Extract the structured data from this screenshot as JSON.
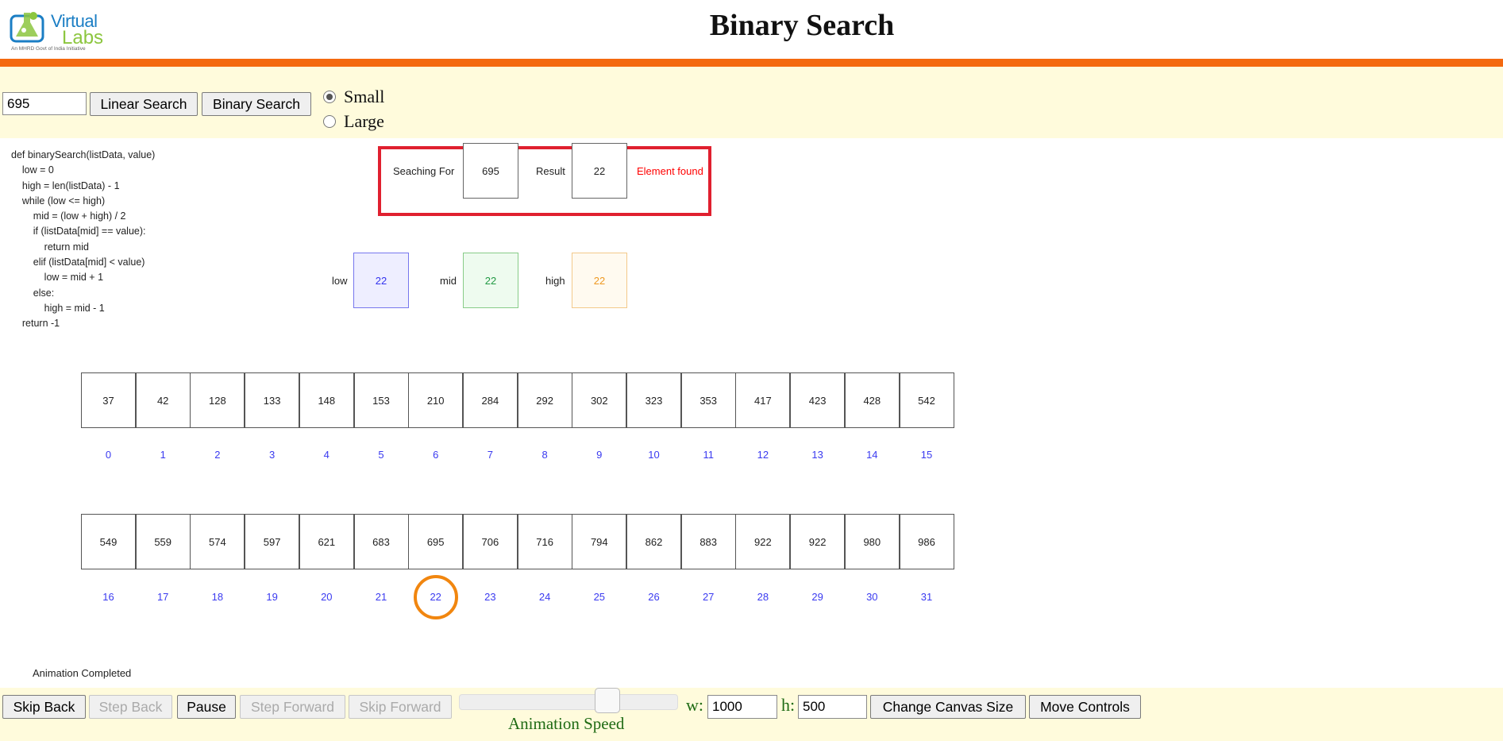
{
  "header": {
    "logo_line1": "Virtual",
    "logo_line2": "Labs",
    "logo_tagline": "An MHRD Govt of India Initiative",
    "title": "Binary Search"
  },
  "top_controls": {
    "search_value": "695",
    "linear_search_label": "Linear Search",
    "binary_search_label": "Binary Search",
    "size_options": [
      {
        "label": "Small",
        "selected": true
      },
      {
        "label": "Large",
        "selected": false
      }
    ]
  },
  "code_lines": [
    "def binarySearch(listData, value)",
    "    low = 0",
    "    high = len(listData) - 1",
    "    while (low <= high)",
    "        mid = (low + high) / 2",
    "        if (listData[mid] == value):",
    "            return mid",
    "        elif (listData[mid] < value)",
    "            low = mid + 1",
    "        else:",
    "            high = mid - 1",
    "    return -1"
  ],
  "search_panel": {
    "searching_for_label": "Seaching For",
    "searching_for_value": "695",
    "result_label": "Result",
    "result_value": "22",
    "message": "Element found",
    "highlight_color": "#e0202f",
    "message_color": "#ff0000"
  },
  "pointers": {
    "low": {
      "label": "low",
      "value": "22",
      "color": "#3333ee"
    },
    "mid": {
      "label": "mid",
      "value": "22",
      "color": "#229944"
    },
    "high": {
      "label": "high",
      "value": "22",
      "color": "#ee9922"
    }
  },
  "array": {
    "rows": [
      {
        "values": [
          "37",
          "42",
          "128",
          "133",
          "148",
          "153",
          "210",
          "284",
          "292",
          "302",
          "323",
          "353",
          "417",
          "423",
          "428",
          "542"
        ],
        "indices": [
          "0",
          "1",
          "2",
          "3",
          "4",
          "5",
          "6",
          "7",
          "8",
          "9",
          "10",
          "11",
          "12",
          "13",
          "14",
          "15"
        ]
      },
      {
        "values": [
          "549",
          "559",
          "574",
          "597",
          "621",
          "683",
          "695",
          "706",
          "716",
          "794",
          "862",
          "883",
          "922",
          "922",
          "980",
          "986"
        ],
        "indices": [
          "16",
          "17",
          "18",
          "19",
          "20",
          "21",
          "22",
          "23",
          "24",
          "25",
          "26",
          "27",
          "28",
          "29",
          "30",
          "31"
        ]
      }
    ],
    "found_index": 22,
    "found_ring_color": "#f1860f",
    "index_color": "#3a3af0"
  },
  "status": "Animation Completed",
  "bottom_controls": {
    "skip_back": "Skip Back",
    "step_back": "Step Back",
    "pause": "Pause",
    "step_forward": "Step Forward",
    "skip_forward": "Skip Forward",
    "animation_speed_label": "Animation Speed",
    "speed_level": 0.7,
    "w_label": "w:",
    "w_value": "1000",
    "h_label": "h:",
    "h_value": "500",
    "change_canvas_label": "Change Canvas Size",
    "move_controls_label": "Move Controls"
  },
  "colors": {
    "accent_orange": "#f4690f",
    "controls_background": "#fffbdc"
  }
}
